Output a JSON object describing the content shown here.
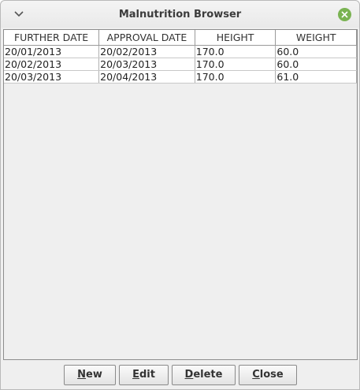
{
  "window": {
    "title": "Malnutrition Browser",
    "menu_icon": "chevron-down-icon",
    "close_icon": "close-icon"
  },
  "table": {
    "columns": [
      "FURTHER DATE",
      "APPROVAL DATE",
      "HEIGHT",
      "WEIGHT"
    ],
    "rows": [
      [
        "20/01/2013",
        "20/02/2013",
        "170.0",
        "60.0"
      ],
      [
        "20/02/2013",
        "20/03/2013",
        "170.0",
        "60.0"
      ],
      [
        "20/03/2013",
        "20/04/2013",
        "170.0",
        "61.0"
      ]
    ]
  },
  "buttons": {
    "new": {
      "mnemonic": "N",
      "rest": "ew"
    },
    "edit": {
      "mnemonic": "E",
      "rest": "dit"
    },
    "delete": {
      "mnemonic": "D",
      "rest": "elete"
    },
    "close": {
      "mnemonic": "C",
      "rest": "lose"
    }
  },
  "colors": {
    "close_button": "#7ab352",
    "window_background": "#efefef"
  }
}
